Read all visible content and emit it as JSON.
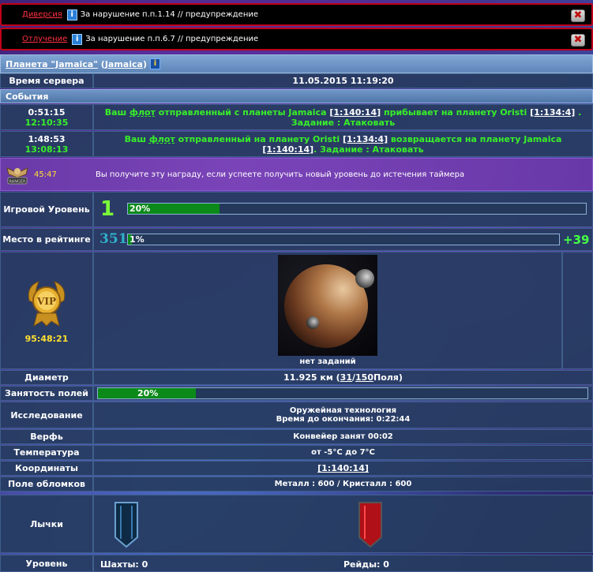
{
  "alerts": [
    {
      "category": "Диверсия",
      "text": "За нарушение п.п.1.14 // предупреждение"
    },
    {
      "category": "Отлучение",
      "text": "За нарушение п.п.6.7 // предупреждение"
    }
  ],
  "planet": {
    "name_link": "Планета \"Jamaica\"",
    "coords_open": "(",
    "coords_link": "Jamaica",
    "coords_close": ")"
  },
  "server_time": {
    "label": "Время сервера",
    "value": "11.05.2015 11:19:20"
  },
  "events": {
    "title": "События",
    "items": [
      {
        "time1": "0:51:15",
        "time2": "12:10:35",
        "part1": "Ваш ",
        "fleet": "флот",
        "part2": " отправленный с планеты Jamaica ",
        "coord1": "[1:140:14]",
        "part3": " прибывает на планету Oristi ",
        "coord2": "[1:134:4]",
        "part4": " . Задание : Атаковать"
      },
      {
        "time1": "1:48:53",
        "time2": "13:08:13",
        "part1": "Ваш ",
        "fleet": "флот",
        "part2": " отправленный на планету Oristi ",
        "coord1": "[1:134:4]",
        "part3": " возвращается на планету Jamaica ",
        "coord2": "[1:140:14]",
        "part4": ". Задание : Атаковать"
      }
    ]
  },
  "reward": {
    "timer": "45:47",
    "badge": "RANGER",
    "text": "Вы получите эту награду, если успеете получить новый уровень до истечения таймера"
  },
  "game_level": {
    "label": "Игровой Уровень",
    "level": "1",
    "progress_text": "20%",
    "progress": 0.2
  },
  "rating": {
    "label": "Место в рейтинге",
    "rank": "351",
    "progress_text": "1%",
    "progress": 0.01,
    "delta": "+39"
  },
  "vip": {
    "badge": "VIP",
    "timer": "95:48:21"
  },
  "planet_panel": {
    "status": "нет заданий"
  },
  "diameter": {
    "label": "Диаметр",
    "prefix": "11.925 км (",
    "used": "31",
    "sep": " / ",
    "total": "150",
    "suffix": " Поля)"
  },
  "fields": {
    "label": "Занятость полей",
    "progress_text": "20%",
    "progress": 0.2
  },
  "research": {
    "label": "Исследование",
    "line1": "Оружейная технология",
    "line2": "Время до окончания: 0:22:44"
  },
  "shipyard": {
    "label": "Верфь",
    "value": "Конвейер занят 00:02"
  },
  "temperature": {
    "label": "Температура",
    "value": "от -5°C до 7°C"
  },
  "coordinates": {
    "label": "Координаты",
    "value": "[1:140:14]"
  },
  "debris": {
    "label": "Поле обломков",
    "value": "Металл : 600 / Кристалл : 600"
  },
  "stripes": {
    "label": "Лычки",
    "left_color": "#0e2a44",
    "right_color": "#b01018"
  },
  "level_row": {
    "label": "Уровень",
    "mines": "Шахты: 0",
    "raids": "Рейды: 0"
  }
}
